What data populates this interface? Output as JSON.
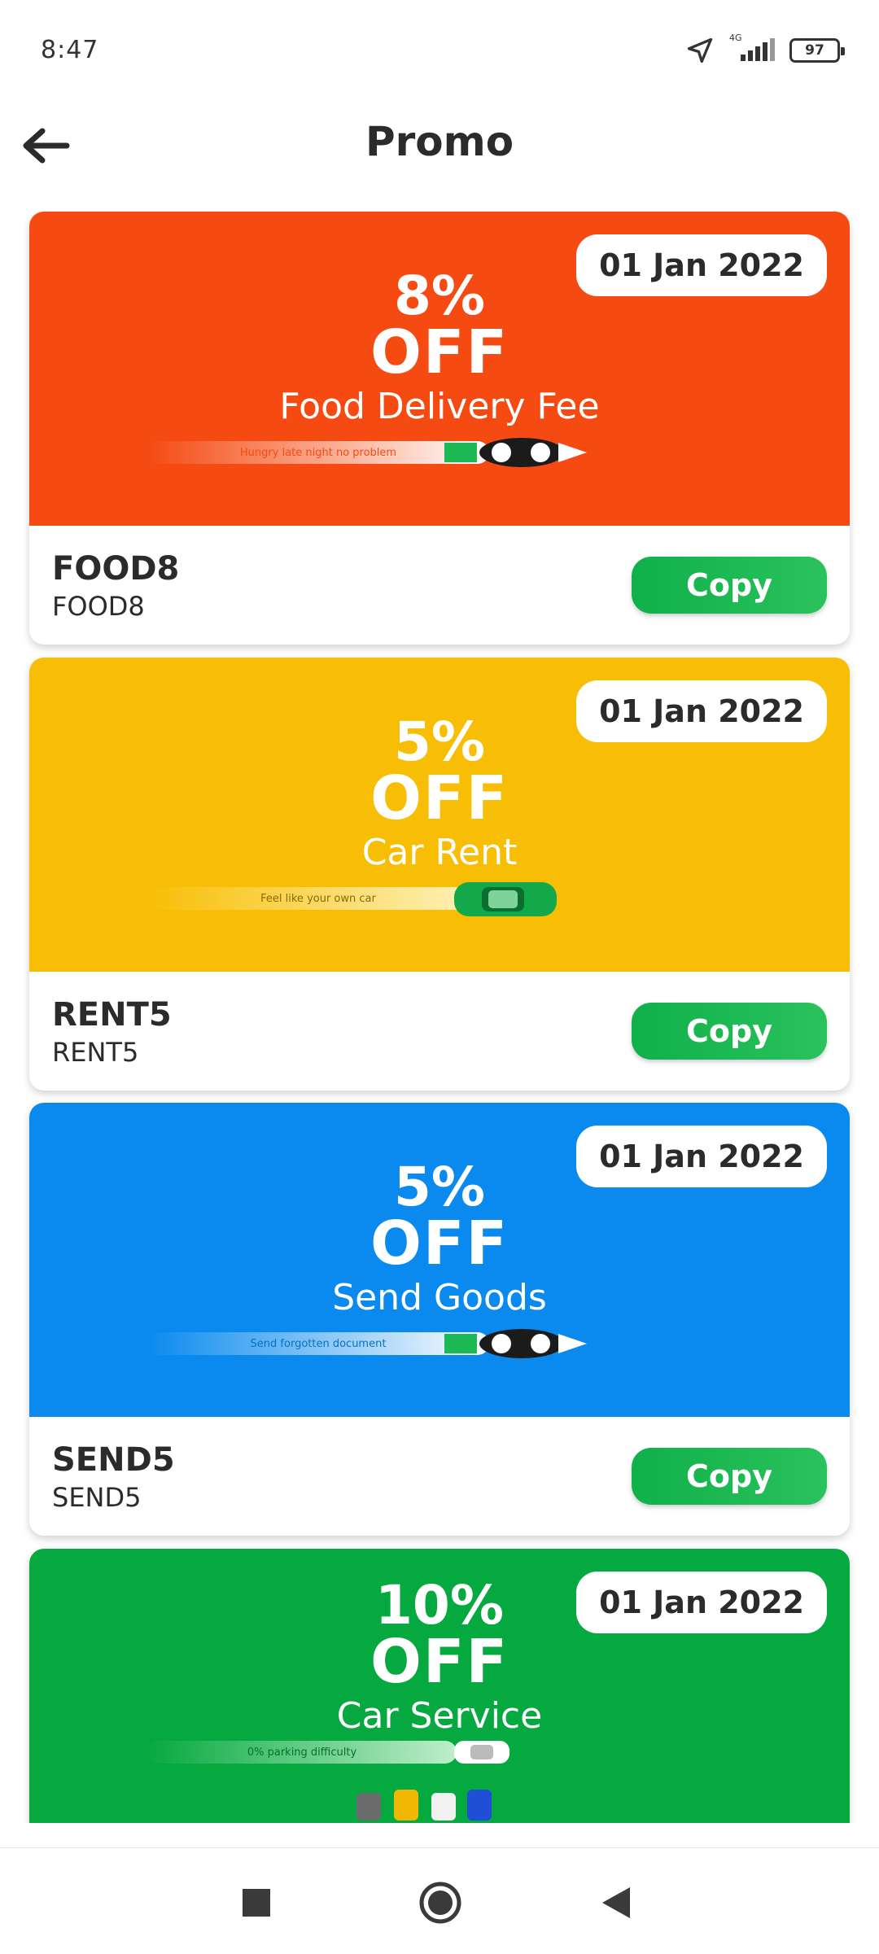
{
  "status_bar": {
    "time": "8:47",
    "network": "4G",
    "battery": "97",
    "icons": [
      "location-arrow-icon",
      "signal-icon",
      "battery-icon"
    ]
  },
  "header": {
    "title": "Promo",
    "back_icon": "arrow-left-icon"
  },
  "promos": [
    {
      "date": "01 Jan 2022",
      "percent": "8%",
      "off": "OFF",
      "service": "Food Delivery Fee",
      "tagline": "Hungry late night no problem",
      "title": "FOOD8",
      "code": "FOOD8",
      "copy_label": "Copy",
      "color": "#f54a12"
    },
    {
      "date": "01 Jan 2022",
      "percent": "5%",
      "off": "OFF",
      "service": "Car Rent",
      "tagline": "Feel like your own car",
      "title": "RENT5",
      "code": "RENT5",
      "copy_label": "Copy",
      "color": "#f8be05"
    },
    {
      "date": "01 Jan 2022",
      "percent": "5%",
      "off": "OFF",
      "service": "Send Goods",
      "tagline": "Send forgotten document",
      "title": "SEND5",
      "code": "SEND5",
      "copy_label": "Copy",
      "color": "#0a8aee"
    },
    {
      "date": "01 Jan 2022",
      "percent": "10%",
      "off": "OFF",
      "service": "Car Service",
      "tagline": "0% parking difficulty",
      "color": "#06a93f"
    }
  ],
  "nav": {
    "recents_icon": "square-icon",
    "home_icon": "circle-icon",
    "back_icon": "triangle-back-icon"
  }
}
